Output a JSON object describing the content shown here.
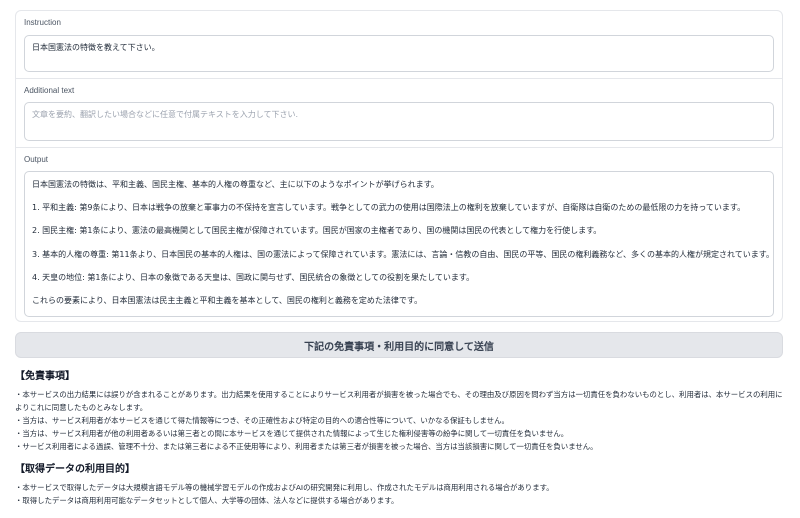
{
  "instruction": {
    "label": "Instruction",
    "value": "日本国憲法の特徴を教えて下さい。"
  },
  "additional_text": {
    "label": "Additional text",
    "placeholder": "文章を要約、翻訳したい場合などに任意で付属テキストを入力して下さい."
  },
  "output": {
    "label": "Output",
    "paragraphs": [
      "日本国憲法の特徴は、平和主義、国民主権、基本的人権の尊重など、主に以下のようなポイントが挙げられます。",
      "1. 平和主義: 第9条により、日本は戦争の放棄と軍事力の不保持を宣言しています。戦争としての武力の使用は国際法上の権利を放棄していますが、自衛隊は自衛のための最低限の力を持っています。",
      "2. 国民主権: 第1条により、憲法の最高機関として国民主権が保障されています。国民が国家の主権者であり、国の機関は国民の代表として権力を行使します。",
      "3. 基本的人権の尊重: 第11条より、日本国民の基本的人権は、国の憲法によって保障されています。憲法には、言論・信教の自由、国民の平等、国民の権利義務など、多くの基本的人権が規定されています。",
      "4. 天皇の地位: 第1条により、日本の象徴である天皇は、国政に関与せず、国民統合の象徴としての役割を果たしています。",
      "これらの要素により、日本国憲法は民主主義と平和主義を基本として、国民の権利と義務を定めた法律です。"
    ]
  },
  "submit_button": {
    "label": "下記の免責事項・利用目的に同意して送信"
  },
  "disclaimer": {
    "title": "【免責事項】",
    "items": [
      "・本サービスの出力結果には誤りが含まれることがあります。出力結果を使用することによりサービス利用者が損害を被った場合でも、その理由及び原因を問わず当方は一切責任を負わないものとし、利用者は、本サービスの利用に",
      "よりこれに同意したものとみなします。",
      "・当方は、サービス利用者が本サービスを通じて得た情報等につき、その正確性および特定の目的への適合性等について、いかなる保証もしません。",
      "・当方は、サービス利用者が他の利用者あるいは第三者との間に本サービスを通じて提供された情報によって生じた権利侵害等の紛争に関して一切責任を負いません。",
      "・サービス利用者による過誤、管理不十分、または第三者による不正使用等により、利用者または第三者が損害を被った場合、当方は当該損害に関して一切責任を負いません。"
    ]
  },
  "purpose": {
    "title": "【取得データの利用目的】",
    "items": [
      "・本サービスで取得したデータは大規模言語モデル等の機械学習モデルの作成およびAIの研究開発に利用し、作成されたモデルは商用利用される場合があります。",
      "・取得したデータは商用利用可能なデータセットとして個人、大学等の団体、法人などに提供する場合があります。"
    ]
  }
}
